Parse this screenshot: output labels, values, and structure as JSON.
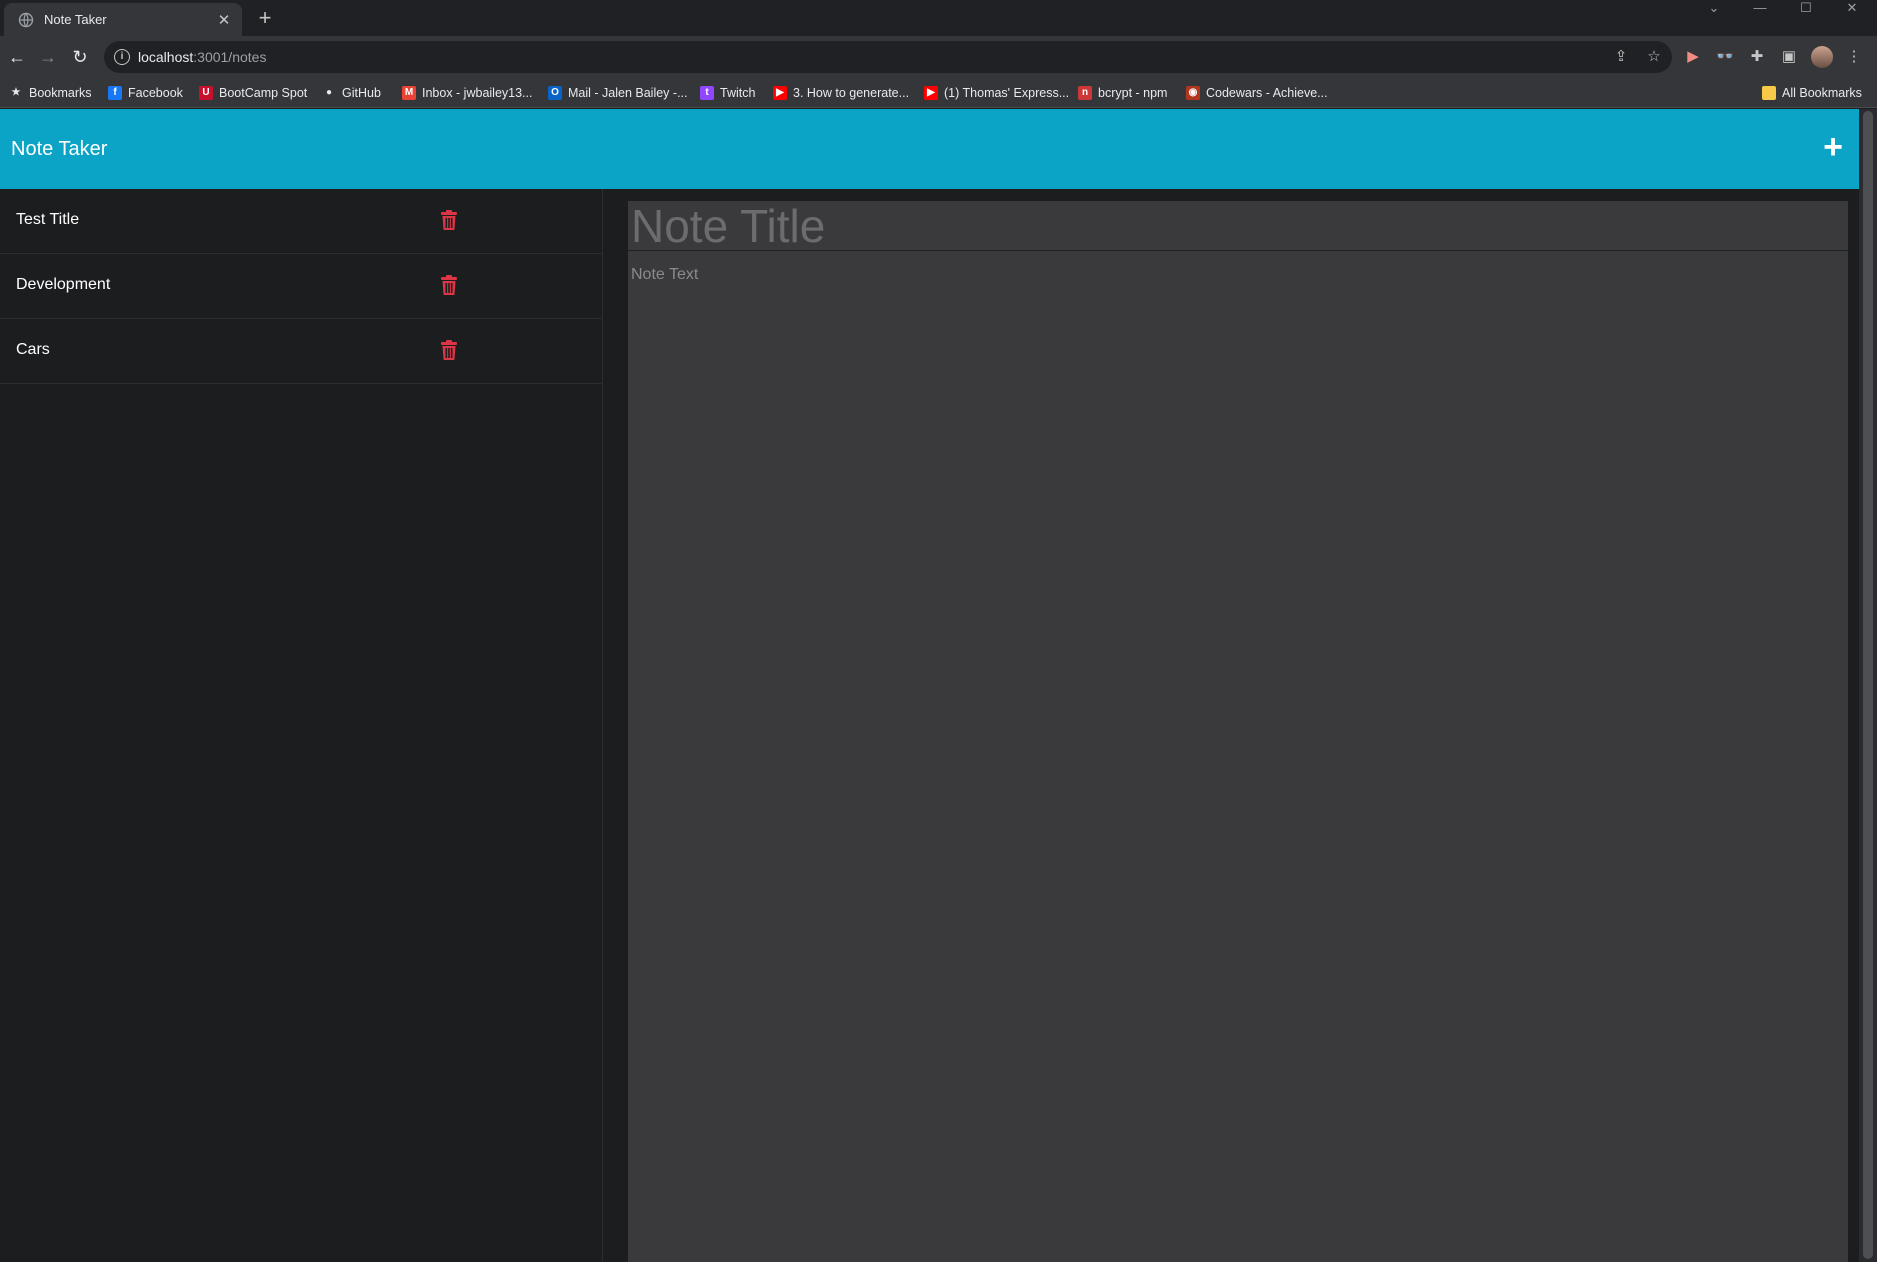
{
  "browser": {
    "tab": {
      "title": "Note Taker",
      "favicon": "globe-icon"
    },
    "window_controls": [
      "minimize",
      "maximize",
      "close"
    ],
    "address_bar": {
      "host": "localhost",
      "path": ":3001/notes"
    }
  },
  "bookmarks": {
    "items": [
      {
        "label": "Bookmarks",
        "icon": "star-icon",
        "color": "#e8eaed"
      },
      {
        "label": "Facebook",
        "icon": "facebook-icon",
        "color": "#1877f2"
      },
      {
        "label": "BootCamp Spot",
        "icon": "bootcamp-icon",
        "color": "#c8102e"
      },
      {
        "label": "GitHub",
        "icon": "github-icon",
        "color": "#e8eaed"
      },
      {
        "label": "Inbox - jwbailey13...",
        "icon": "gmail-icon",
        "color": "#ea4335"
      },
      {
        "label": "Mail - Jalen Bailey -...",
        "icon": "outlook-icon",
        "color": "#0a64c8"
      },
      {
        "label": "Twitch",
        "icon": "twitch-icon",
        "color": "#9146ff"
      },
      {
        "label": "3. How to generate...",
        "icon": "youtube-icon",
        "color": "#ff0000"
      },
      {
        "label": "(1) Thomas' Express...",
        "icon": "youtube-icon",
        "color": "#ff0000"
      },
      {
        "label": "bcrypt - npm",
        "icon": "npm-icon",
        "color": "#cb3837"
      },
      {
        "label": "Codewars - Achieve...",
        "icon": "codewars-icon",
        "color": "#b1361e"
      }
    ],
    "all_bookmarks": "All Bookmarks"
  },
  "app": {
    "brand": "Note Taker",
    "add_label": "+",
    "accent_color": "#0ca4c6",
    "delete_color": "#dc3545",
    "notes": [
      {
        "title": "Test Title"
      },
      {
        "title": "Development"
      },
      {
        "title": "Cars"
      }
    ],
    "editor": {
      "title_placeholder": "Note Title",
      "text_placeholder": "Note Text"
    }
  }
}
